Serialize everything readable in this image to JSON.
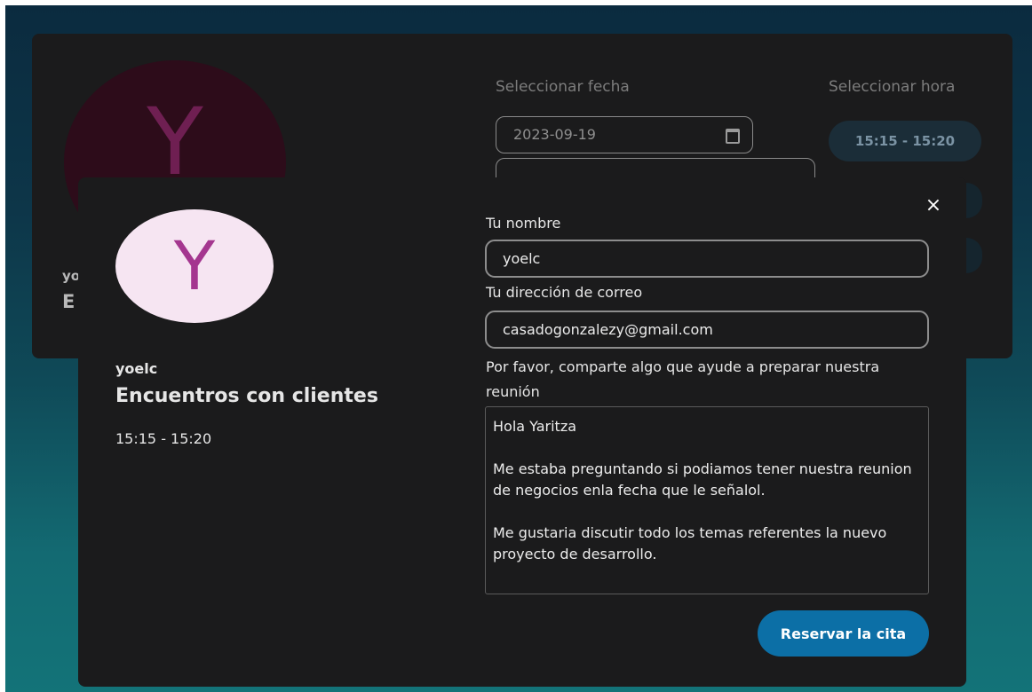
{
  "background": {
    "host_name_partial": "yo",
    "title_partial": "E",
    "date_label": "Seleccionar fecha",
    "time_label": "Seleccionar hora",
    "date_value": "2023-09-19",
    "time_slot": "15:15 - 15:20",
    "icons": {
      "calendar": "calendar-icon"
    }
  },
  "modal": {
    "close_icon": "×",
    "avatar_letter": "Y",
    "host_name": "yoelc",
    "event_title": "Encuentros con clientes",
    "event_time": "15:15 - 15:20",
    "form": {
      "name_label": "Tu nombre",
      "name_value": "yoelc",
      "email_label": "Tu dirección de correo",
      "email_value": "casadogonzalezy@gmail.com",
      "notes_label": "Por favor, comparte algo que ayude a preparar nuestra reunión",
      "notes_value": "Hola Yaritza\n\nMe estaba preguntando si podiamos tener nuestra reunion de negocios enla fecha que le señalol.\n\nMe gustaria discutir todo los temas referentes la nuevo proyecto de desarrollo.",
      "submit_label": "Reservar la cita"
    }
  },
  "colors": {
    "accent": "#0c6fa6",
    "avatar_bg": "#f6e5f2",
    "avatar_letter": "#a4368f",
    "card_bg": "#1b1b1c"
  }
}
